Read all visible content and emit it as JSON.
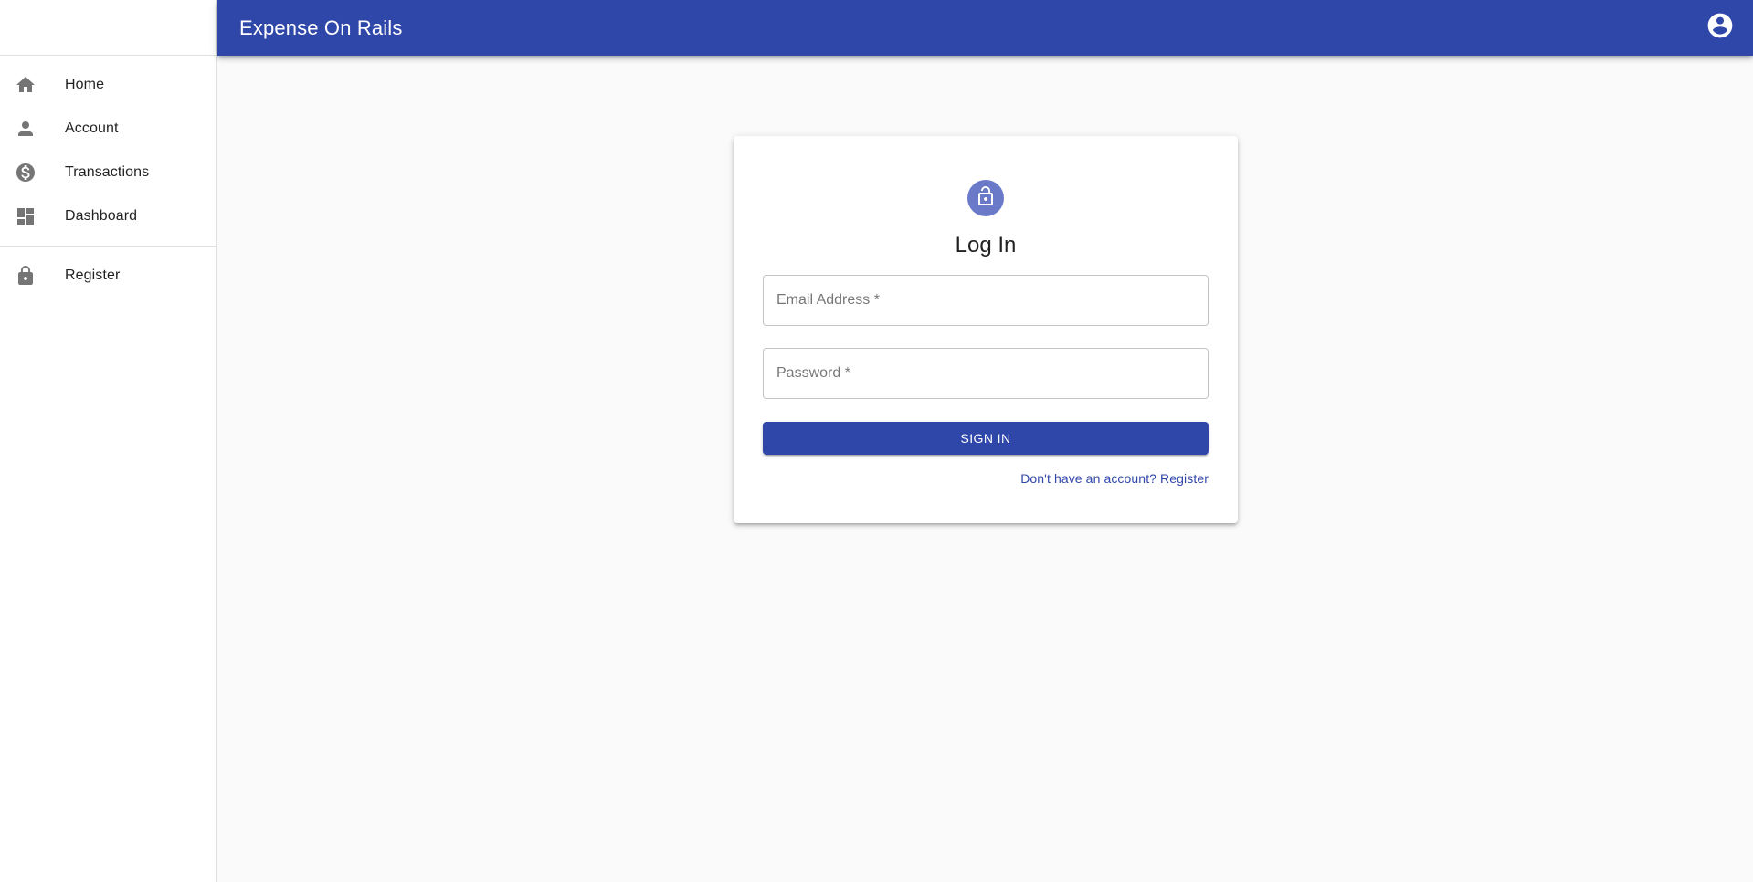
{
  "app": {
    "title": "Expense On Rails",
    "brand_color": "#3047aa"
  },
  "header": {
    "account_icon": "account-circle-icon"
  },
  "sidebar": {
    "items": [
      {
        "label": "Home",
        "icon": "home-icon"
      },
      {
        "label": "Account",
        "icon": "person-icon"
      },
      {
        "label": "Transactions",
        "icon": "dollar-circle-icon"
      },
      {
        "label": "Dashboard",
        "icon": "dashboard-icon"
      }
    ],
    "secondary_items": [
      {
        "label": "Register",
        "icon": "lock-icon"
      }
    ]
  },
  "login": {
    "title": "Log In",
    "avatar_icon": "lock-open-icon",
    "avatar_color": "#6a7ac8",
    "email": {
      "placeholder": "Email Address *",
      "value": ""
    },
    "password": {
      "placeholder": "Password *",
      "value": ""
    },
    "submit_label": "Sign In",
    "register_link": "Don't have an account? Register"
  }
}
